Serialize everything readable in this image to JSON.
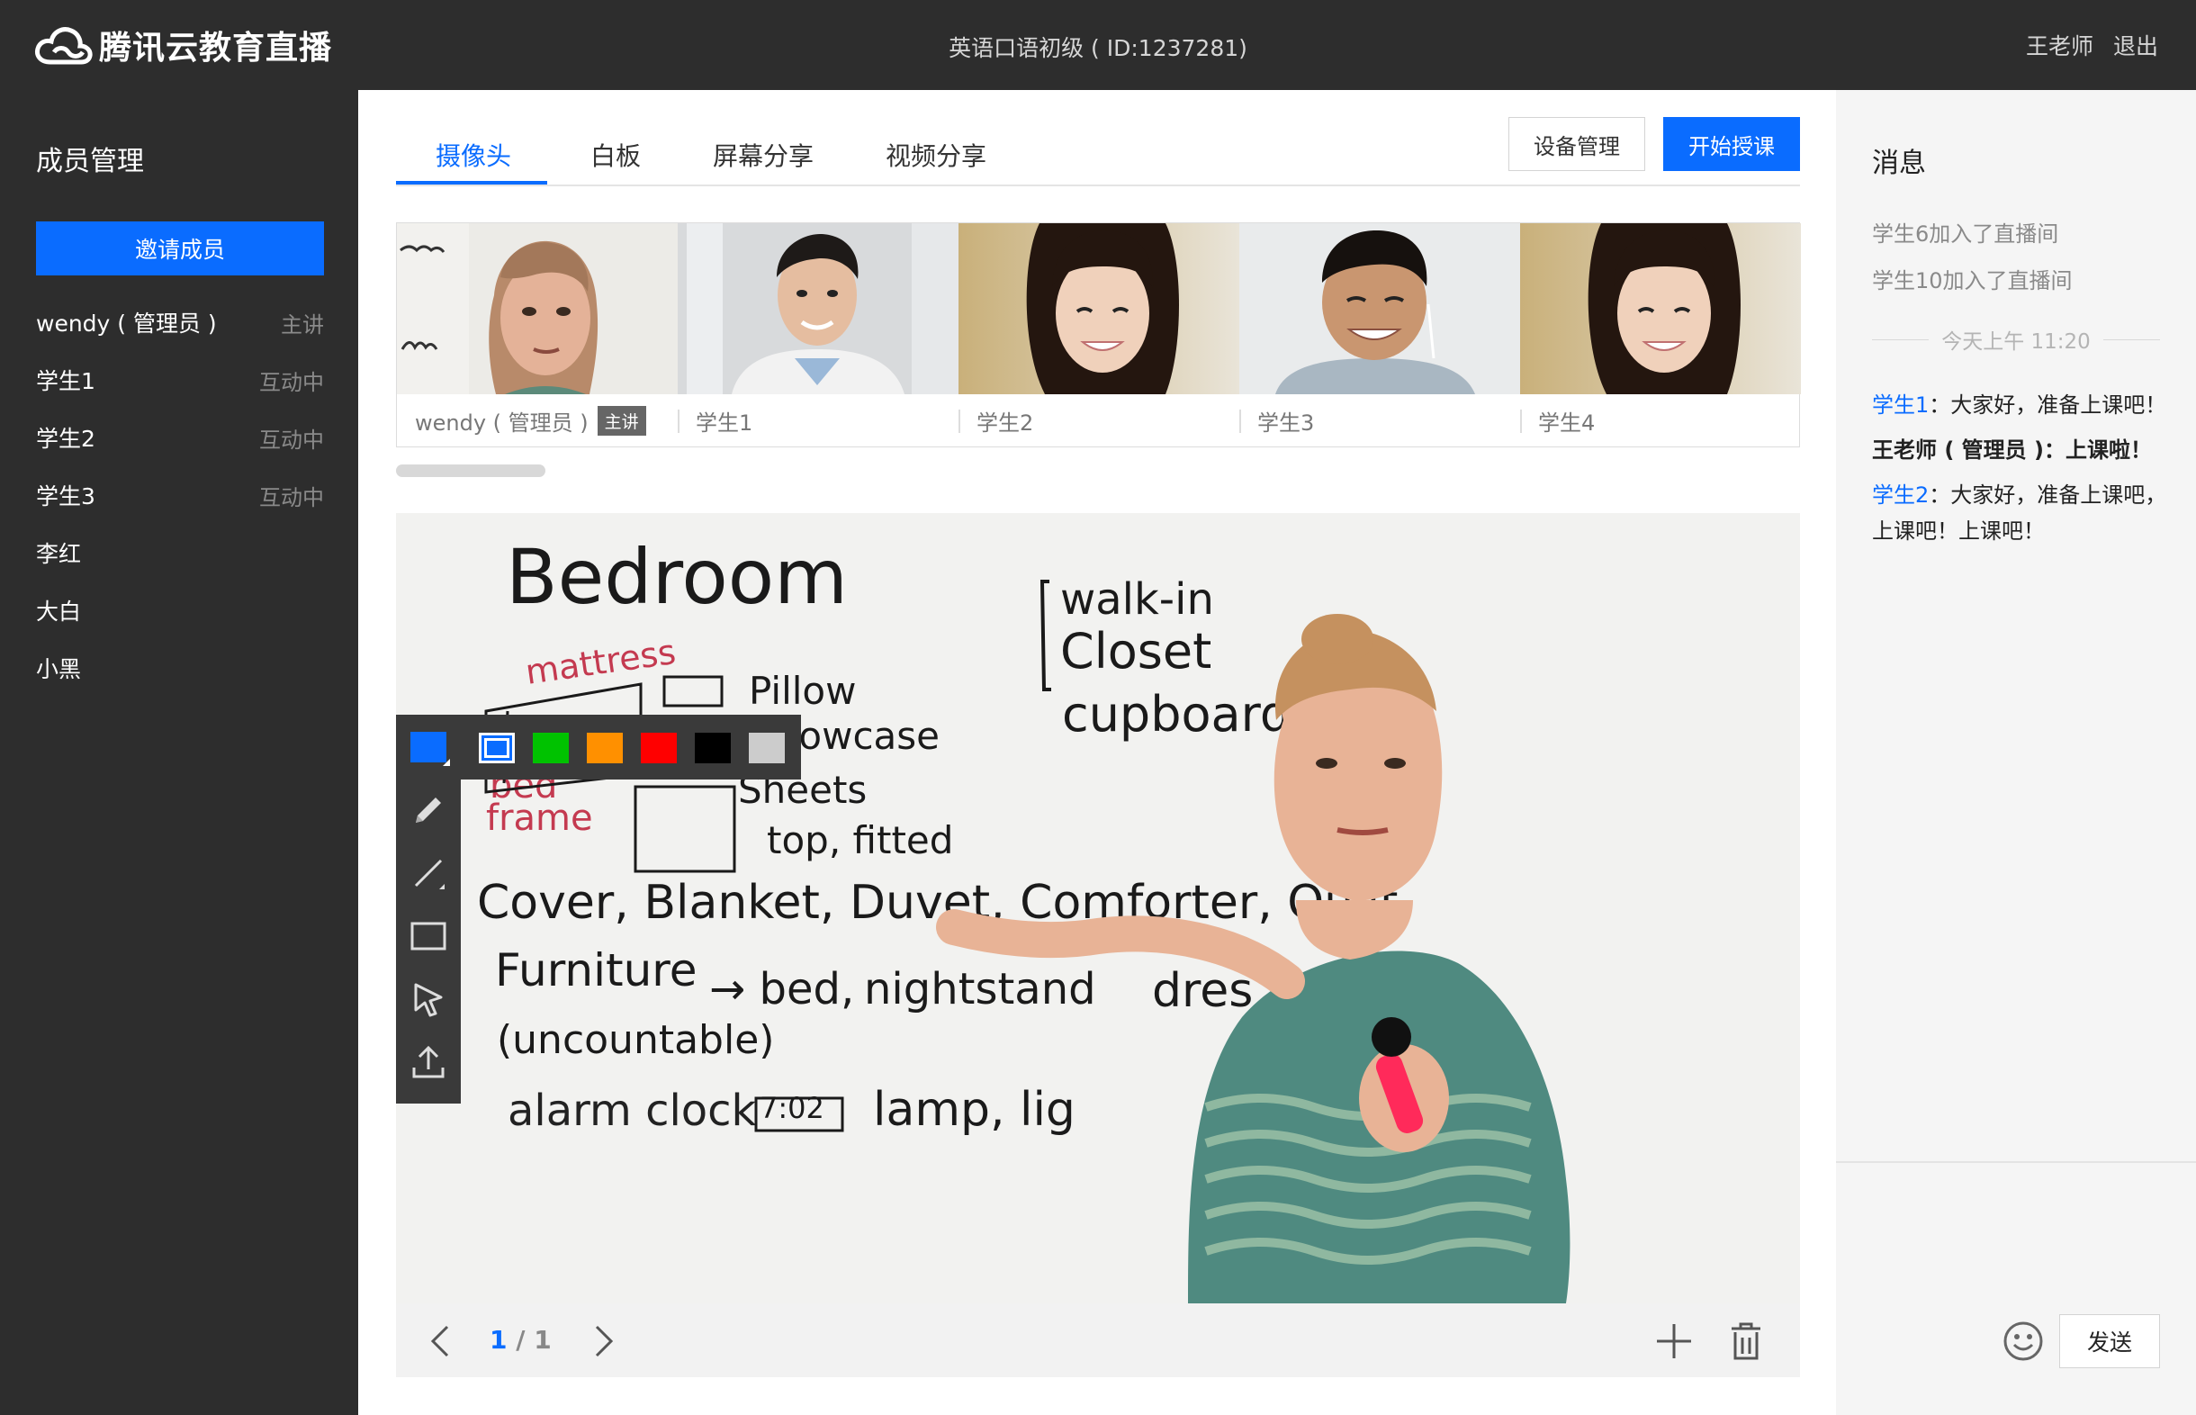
{
  "app": {
    "name": "腾讯云教育直播",
    "course_title": "英语口语初级 ( ID:1237281)",
    "user_name": "王老师",
    "logout_label": "退出"
  },
  "sidebar": {
    "title": "成员管理",
    "invite_label": "邀请成员",
    "members": [
      {
        "name": "wendy ( 管理员 )",
        "status": "主讲"
      },
      {
        "name": "学生1",
        "status": "互动中"
      },
      {
        "name": "学生2",
        "status": "互动中"
      },
      {
        "name": "学生3",
        "status": "互动中"
      },
      {
        "name": "李红",
        "status": ""
      },
      {
        "name": "大白",
        "status": ""
      },
      {
        "name": "小黑",
        "status": ""
      }
    ]
  },
  "main": {
    "tabs": [
      {
        "label": "摄像头",
        "active": true
      },
      {
        "label": "白板",
        "active": false
      },
      {
        "label": "屏幕分享",
        "active": false
      },
      {
        "label": "视频分享",
        "active": false
      }
    ],
    "device_btn": "设备管理",
    "start_btn": "开始授课",
    "thumbnails": [
      {
        "label": "wendy ( 管理员 )",
        "badge": "主讲"
      },
      {
        "label": "学生1",
        "badge": ""
      },
      {
        "label": "学生2",
        "badge": ""
      },
      {
        "label": "学生3",
        "badge": ""
      },
      {
        "label": "学生4",
        "badge": ""
      }
    ],
    "whiteboard_text": {
      "title": "Bedroom",
      "w1": "mattress",
      "w2": "Pillow",
      "w3": "Pillowcase",
      "w4": "bed",
      "w5": "frame",
      "w6": "Sheets",
      "w7": "top, fitted",
      "w8": "walk-in",
      "w9": "Closet",
      "w10": "cupboard",
      "w11": "Cover, Blanket, Duvet, Comforter, Quilt",
      "w12": "Furniture",
      "w13": "→ bed,",
      "w14": "nightstand",
      "w15": "dres",
      "w16": "(uncountable)",
      "w17": "alarm clock",
      "w18": "7:02",
      "w19": "lamp, lig"
    },
    "colors": [
      "#0a6cff",
      "#00c200",
      "#ff9000",
      "#ff0000",
      "#000000",
      "#cccccc"
    ],
    "current_color": "#0a6cff",
    "tools": [
      "pen-icon",
      "line-icon",
      "rectangle-icon",
      "select-icon",
      "upload-icon"
    ],
    "page_current": "1",
    "page_total": "/ 1"
  },
  "chat": {
    "title": "消息",
    "system_msgs": [
      "学生6加入了直播间",
      "学生10加入了直播间"
    ],
    "time_divider": "今天上午 11:20",
    "messages": [
      {
        "who": "学生1",
        "text": "：大家好，准备上课吧！"
      },
      {
        "who": "王老师 ( 管理员 )",
        "text": "：上课啦！"
      },
      {
        "who": "学生2",
        "text": "：大家好，准备上课吧，上课吧！上课吧！"
      }
    ],
    "send_label": "发送"
  }
}
